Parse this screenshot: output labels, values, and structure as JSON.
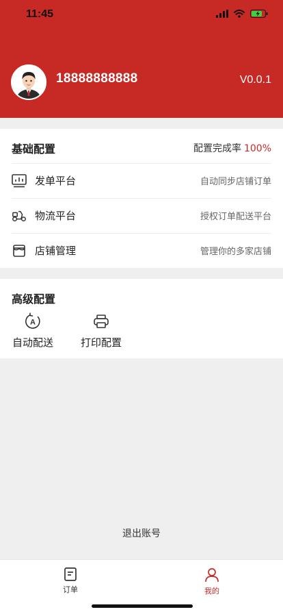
{
  "status_bar": {
    "time": "11:45"
  },
  "profile": {
    "phone": "18888888888",
    "version": "V0.0.1"
  },
  "basic_config": {
    "title": "基础配置",
    "rate_label": "配置完成率",
    "rate_value": "100%",
    "items": [
      {
        "label": "发单平台",
        "desc": "自动同步店铺订单",
        "icon": "chart-board-icon"
      },
      {
        "label": "物流平台",
        "desc": "授权订单配送平台",
        "icon": "scooter-icon"
      },
      {
        "label": "店铺管理",
        "desc": "管理你的多家店铺",
        "icon": "store-icon"
      }
    ]
  },
  "advanced_config": {
    "title": "高级配置",
    "tools": [
      {
        "label": "自动配送",
        "icon": "auto-rotate-icon"
      },
      {
        "label": "打印配置",
        "icon": "printer-icon"
      }
    ]
  },
  "logout": "退出账号",
  "tabbar": {
    "tabs": [
      {
        "label": "订单",
        "icon": "order-icon",
        "active": false
      },
      {
        "label": "我的",
        "icon": "user-icon",
        "active": true
      }
    ]
  },
  "colors": {
    "brand": "#c72a25",
    "background": "#efefef"
  }
}
